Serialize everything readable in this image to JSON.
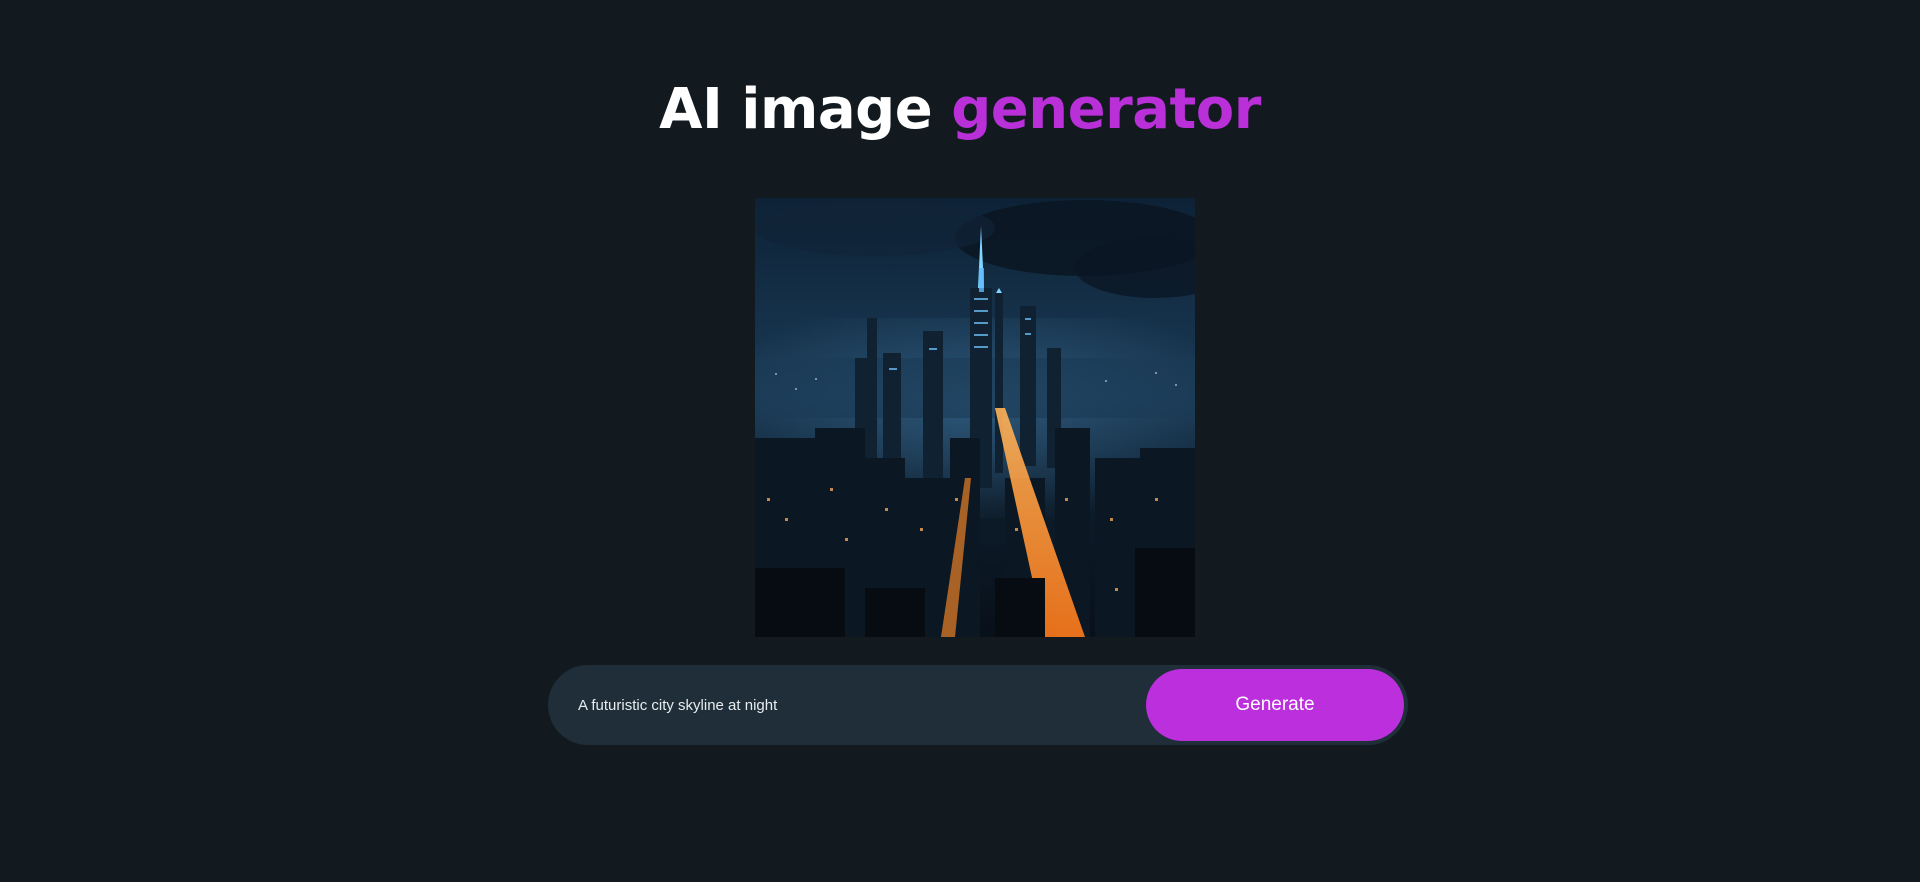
{
  "header": {
    "title_main": "AI image",
    "title_accent": "generator",
    "accent_color": "#b92fd8"
  },
  "generated_image": {
    "alt": "A futuristic city skyline at night"
  },
  "prompt_form": {
    "input_value": "A futuristic city skyline at night",
    "button_label": "Generate",
    "button_color": "#bb2fdc"
  },
  "colors": {
    "background": "#121a20",
    "input_background": "#1f2e38"
  }
}
